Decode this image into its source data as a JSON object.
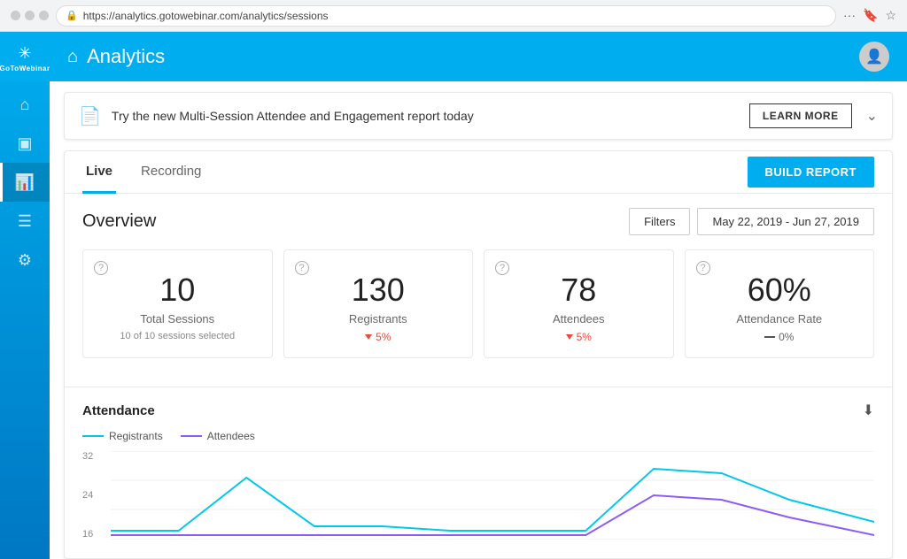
{
  "browser": {
    "url": "https://analytics.gotowebinar.com/analytics/sessions",
    "actions": [
      "···",
      "🔖",
      "☆"
    ]
  },
  "sidebar": {
    "logo_symbol": "✳",
    "logo_text": "GoToWebinar",
    "nav_items": [
      {
        "id": "home",
        "icon": "⌂",
        "active": false
      },
      {
        "id": "monitor",
        "icon": "▣",
        "active": false
      },
      {
        "id": "chart",
        "icon": "▐",
        "active": true
      },
      {
        "id": "table",
        "icon": "☰",
        "active": false
      },
      {
        "id": "settings",
        "icon": "⚙",
        "active": false
      }
    ]
  },
  "header": {
    "title": "Analytics"
  },
  "banner": {
    "text": "Try the new Multi-Session Attendee and Engagement report today",
    "button_label": "LEARN MORE"
  },
  "tabs": [
    {
      "id": "live",
      "label": "Live",
      "active": true
    },
    {
      "id": "recording",
      "label": "Recording",
      "active": false
    }
  ],
  "build_report_label": "BUILD REPORT",
  "overview": {
    "title": "Overview",
    "filter_label": "Filters",
    "date_range": "May 22, 2019 - Jun 27, 2019",
    "stats": [
      {
        "id": "total-sessions",
        "value": "10",
        "label": "Total Sessions",
        "sub": "10 of 10 sessions selected",
        "change_type": "none"
      },
      {
        "id": "registrants",
        "value": "130",
        "label": "Registrants",
        "change": "5%",
        "change_type": "down"
      },
      {
        "id": "attendees",
        "value": "78",
        "label": "Attendees",
        "change": "5%",
        "change_type": "down"
      },
      {
        "id": "attendance-rate",
        "value": "60%",
        "label": "Attendance Rate",
        "change": "0%",
        "change_type": "neutral"
      }
    ]
  },
  "attendance_chart": {
    "title": "Attendance",
    "legend": [
      {
        "id": "registrants",
        "label": "Registrants",
        "color": "cyan"
      },
      {
        "id": "attendees",
        "label": "Attendees",
        "color": "purple"
      }
    ],
    "y_labels": [
      "32",
      "24",
      "16"
    ]
  }
}
